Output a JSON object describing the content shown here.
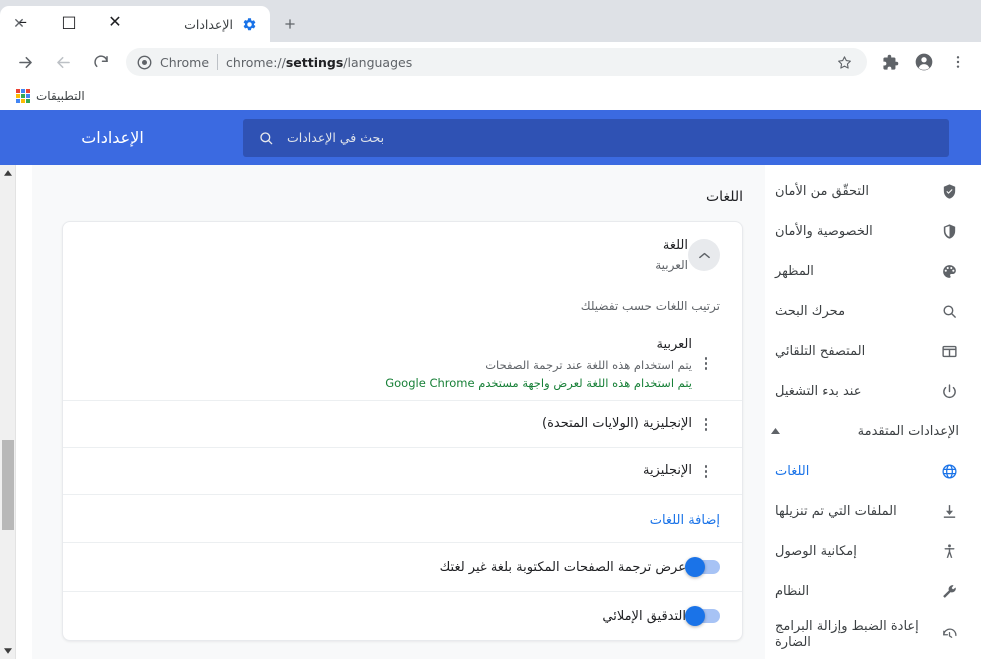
{
  "window": {
    "controls": [
      {
        "name": "close",
        "glyph": "✕"
      },
      {
        "name": "maximize",
        "glyph": "□"
      },
      {
        "name": "minimize",
        "glyph": "–"
      }
    ]
  },
  "tab": {
    "title": "الإعدادات",
    "favicon": "gear-icon",
    "close_glyph": "✕",
    "newtab_glyph": "+"
  },
  "toolbar": {
    "forward_glyph": "→",
    "back_glyph": "←",
    "reload_glyph": "↺",
    "omnibox": {
      "chip": "Chrome",
      "url_prefix": "chrome://",
      "url_bold": "settings",
      "url_suffix": "/languages",
      "star": "☆"
    },
    "extensions_label": "extensions-icon",
    "profile_label": "profile-icon",
    "menu_label": "more-menu-icon"
  },
  "bookmarks": {
    "apps_label": "التطبيقات"
  },
  "settings_header": {
    "title": "الإعدادات",
    "search_placeholder": "بحث في الإعدادات"
  },
  "sidebar": {
    "items": [
      {
        "label": "التحقّق من الأمان",
        "icon": "shield-check-icon",
        "active": false
      },
      {
        "label": "الخصوصية والأمان",
        "icon": "shield-icon",
        "active": false
      },
      {
        "label": "المظهر",
        "icon": "palette-icon",
        "active": false
      },
      {
        "label": "محرك البحث",
        "icon": "search-icon",
        "active": false
      },
      {
        "label": "المتصفح التلقائي",
        "icon": "browser-icon",
        "active": false
      },
      {
        "label": "عند بدء التشغيل",
        "icon": "power-icon",
        "active": false
      }
    ],
    "group": {
      "label": "الإعدادات المتقدمة",
      "arrow": "▲"
    },
    "advanced_items": [
      {
        "label": "اللغات",
        "icon": "globe-icon",
        "active": true
      },
      {
        "label": "الملفات التي تم تنزيلها",
        "icon": "download-icon",
        "active": false
      },
      {
        "label": "إمكانية الوصول",
        "icon": "accessibility-icon",
        "active": false
      },
      {
        "label": "النظام",
        "icon": "wrench-icon",
        "active": false
      },
      {
        "label": "إعادة الضبط وإزالة البرامج الضارة",
        "icon": "restore-icon",
        "active": false
      }
    ]
  },
  "main": {
    "page_title": "اللغات",
    "language_card": {
      "title": "اللغة",
      "subtitle": "العربية",
      "collapse_glyph": "⌃",
      "list_header": "ترتيب اللغات حسب تفضيلك",
      "languages": [
        {
          "name": "العربية",
          "note1": "يتم استخدام هذه اللغة عند ترجمة الصفحات",
          "note2": "يتم استخدام هذه اللغة لعرض واجهة مستخدم Google Chrome"
        },
        {
          "name": "الإنجليزية (الولايات المتحدة)",
          "note1": "",
          "note2": ""
        },
        {
          "name": "الإنجليزية",
          "note1": "",
          "note2": ""
        }
      ],
      "add_language_link": "إضافة اللغات",
      "toggles": [
        {
          "label": "عرض ترجمة الصفحات المكتوبة بلغة غير لغتك",
          "on": true
        },
        {
          "label": "التدقيق الإملائي",
          "on": true
        }
      ]
    }
  },
  "colors": {
    "header_blue": "#3b6ae1",
    "search_blue": "#2f52b4",
    "accent_blue": "#1a73e8",
    "green_note": "#188038",
    "tabstrip": "#dee1e6",
    "page_bg": "#f8f9fa"
  }
}
